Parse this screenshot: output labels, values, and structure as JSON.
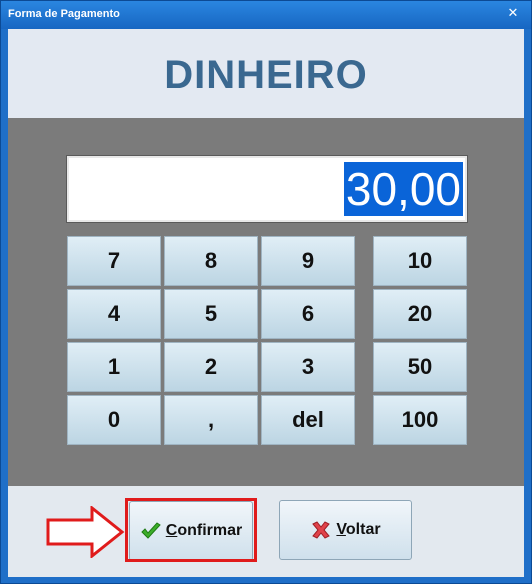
{
  "window": {
    "title": "Forma de Pagamento",
    "close_glyph": "✕"
  },
  "header": {
    "title": "DINHEIRO"
  },
  "display": {
    "value": "30,00"
  },
  "keypad": {
    "digits": [
      [
        "7",
        "8",
        "9"
      ],
      [
        "4",
        "5",
        "6"
      ],
      [
        "1",
        "2",
        "3"
      ],
      [
        "0",
        ",",
        "del"
      ]
    ],
    "quick_amounts": [
      "10",
      "20",
      "50",
      "100"
    ]
  },
  "buttons": {
    "confirm": {
      "mnemonic": "C",
      "rest": "onfirmar",
      "icon": "checkmark-icon",
      "icon_color": "#2e9e1f"
    },
    "back": {
      "mnemonic": "V",
      "rest": "oltar",
      "icon": "x-icon",
      "icon_color": "#d8323a"
    }
  },
  "annotation": {
    "arrow_color": "#e01b1b",
    "highlight_color": "#e01b1b"
  }
}
